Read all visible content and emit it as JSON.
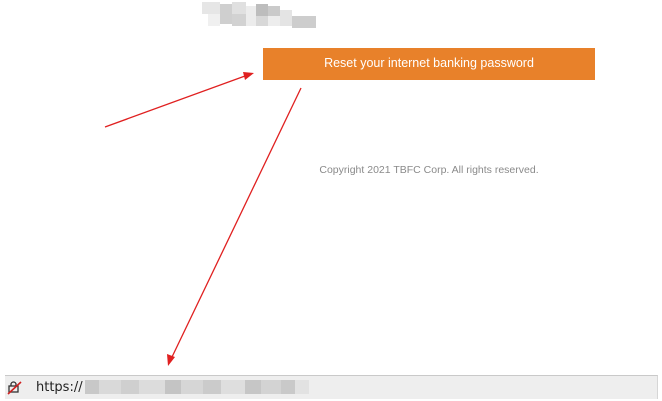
{
  "reset_button": {
    "label": "Reset your internet banking password",
    "color": "#e8812a"
  },
  "footer": {
    "copyright": "Copyright 2021 TBFC Corp. All rights reserved."
  },
  "status_bar": {
    "url_prefix": "https://",
    "icon": "no-security-icon"
  },
  "annotations": {
    "arrow_color": "#e02020"
  }
}
